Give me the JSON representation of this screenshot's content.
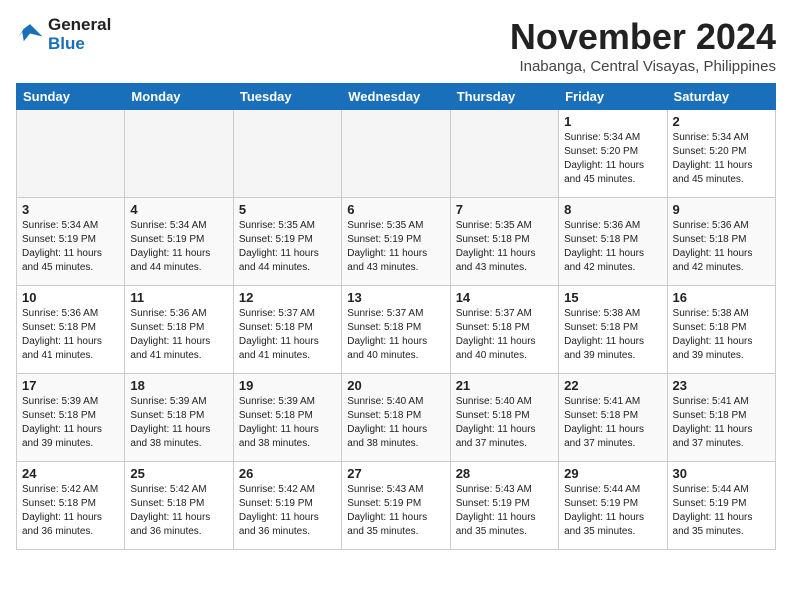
{
  "header": {
    "logo_line1": "General",
    "logo_line2": "Blue",
    "month": "November 2024",
    "location": "Inabanga, Central Visayas, Philippines"
  },
  "weekdays": [
    "Sunday",
    "Monday",
    "Tuesday",
    "Wednesday",
    "Thursday",
    "Friday",
    "Saturday"
  ],
  "weeks": [
    [
      {
        "day": "",
        "info": ""
      },
      {
        "day": "",
        "info": ""
      },
      {
        "day": "",
        "info": ""
      },
      {
        "day": "",
        "info": ""
      },
      {
        "day": "",
        "info": ""
      },
      {
        "day": "1",
        "info": "Sunrise: 5:34 AM\nSunset: 5:20 PM\nDaylight: 11 hours\nand 45 minutes."
      },
      {
        "day": "2",
        "info": "Sunrise: 5:34 AM\nSunset: 5:20 PM\nDaylight: 11 hours\nand 45 minutes."
      }
    ],
    [
      {
        "day": "3",
        "info": "Sunrise: 5:34 AM\nSunset: 5:19 PM\nDaylight: 11 hours\nand 45 minutes."
      },
      {
        "day": "4",
        "info": "Sunrise: 5:34 AM\nSunset: 5:19 PM\nDaylight: 11 hours\nand 44 minutes."
      },
      {
        "day": "5",
        "info": "Sunrise: 5:35 AM\nSunset: 5:19 PM\nDaylight: 11 hours\nand 44 minutes."
      },
      {
        "day": "6",
        "info": "Sunrise: 5:35 AM\nSunset: 5:19 PM\nDaylight: 11 hours\nand 43 minutes."
      },
      {
        "day": "7",
        "info": "Sunrise: 5:35 AM\nSunset: 5:18 PM\nDaylight: 11 hours\nand 43 minutes."
      },
      {
        "day": "8",
        "info": "Sunrise: 5:36 AM\nSunset: 5:18 PM\nDaylight: 11 hours\nand 42 minutes."
      },
      {
        "day": "9",
        "info": "Sunrise: 5:36 AM\nSunset: 5:18 PM\nDaylight: 11 hours\nand 42 minutes."
      }
    ],
    [
      {
        "day": "10",
        "info": "Sunrise: 5:36 AM\nSunset: 5:18 PM\nDaylight: 11 hours\nand 41 minutes."
      },
      {
        "day": "11",
        "info": "Sunrise: 5:36 AM\nSunset: 5:18 PM\nDaylight: 11 hours\nand 41 minutes."
      },
      {
        "day": "12",
        "info": "Sunrise: 5:37 AM\nSunset: 5:18 PM\nDaylight: 11 hours\nand 41 minutes."
      },
      {
        "day": "13",
        "info": "Sunrise: 5:37 AM\nSunset: 5:18 PM\nDaylight: 11 hours\nand 40 minutes."
      },
      {
        "day": "14",
        "info": "Sunrise: 5:37 AM\nSunset: 5:18 PM\nDaylight: 11 hours\nand 40 minutes."
      },
      {
        "day": "15",
        "info": "Sunrise: 5:38 AM\nSunset: 5:18 PM\nDaylight: 11 hours\nand 39 minutes."
      },
      {
        "day": "16",
        "info": "Sunrise: 5:38 AM\nSunset: 5:18 PM\nDaylight: 11 hours\nand 39 minutes."
      }
    ],
    [
      {
        "day": "17",
        "info": "Sunrise: 5:39 AM\nSunset: 5:18 PM\nDaylight: 11 hours\nand 39 minutes."
      },
      {
        "day": "18",
        "info": "Sunrise: 5:39 AM\nSunset: 5:18 PM\nDaylight: 11 hours\nand 38 minutes."
      },
      {
        "day": "19",
        "info": "Sunrise: 5:39 AM\nSunset: 5:18 PM\nDaylight: 11 hours\nand 38 minutes."
      },
      {
        "day": "20",
        "info": "Sunrise: 5:40 AM\nSunset: 5:18 PM\nDaylight: 11 hours\nand 38 minutes."
      },
      {
        "day": "21",
        "info": "Sunrise: 5:40 AM\nSunset: 5:18 PM\nDaylight: 11 hours\nand 37 minutes."
      },
      {
        "day": "22",
        "info": "Sunrise: 5:41 AM\nSunset: 5:18 PM\nDaylight: 11 hours\nand 37 minutes."
      },
      {
        "day": "23",
        "info": "Sunrise: 5:41 AM\nSunset: 5:18 PM\nDaylight: 11 hours\nand 37 minutes."
      }
    ],
    [
      {
        "day": "24",
        "info": "Sunrise: 5:42 AM\nSunset: 5:18 PM\nDaylight: 11 hours\nand 36 minutes."
      },
      {
        "day": "25",
        "info": "Sunrise: 5:42 AM\nSunset: 5:18 PM\nDaylight: 11 hours\nand 36 minutes."
      },
      {
        "day": "26",
        "info": "Sunrise: 5:42 AM\nSunset: 5:19 PM\nDaylight: 11 hours\nand 36 minutes."
      },
      {
        "day": "27",
        "info": "Sunrise: 5:43 AM\nSunset: 5:19 PM\nDaylight: 11 hours\nand 35 minutes."
      },
      {
        "day": "28",
        "info": "Sunrise: 5:43 AM\nSunset: 5:19 PM\nDaylight: 11 hours\nand 35 minutes."
      },
      {
        "day": "29",
        "info": "Sunrise: 5:44 AM\nSunset: 5:19 PM\nDaylight: 11 hours\nand 35 minutes."
      },
      {
        "day": "30",
        "info": "Sunrise: 5:44 AM\nSunset: 5:19 PM\nDaylight: 11 hours\nand 35 minutes."
      }
    ]
  ]
}
